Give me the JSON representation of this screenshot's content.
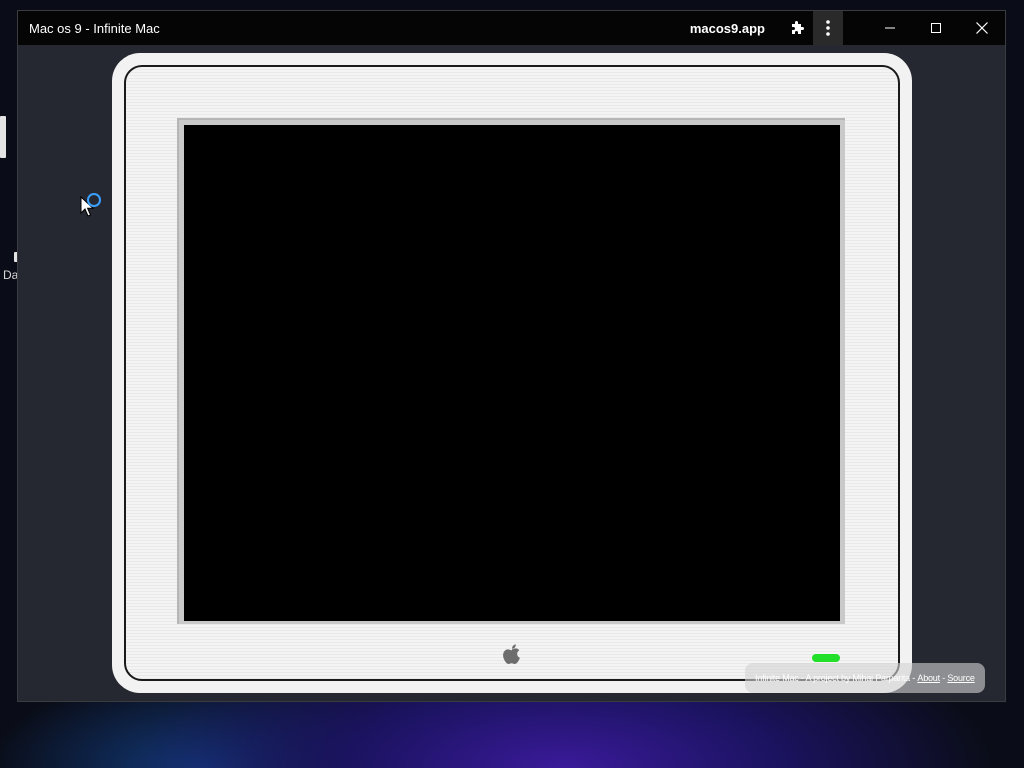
{
  "window": {
    "title": "Mac os 9 - Infinite Mac",
    "domain": "macos9.app"
  },
  "titlebar_icons": {
    "extensions": "puzzle-icon",
    "menu": "kebab-menu-icon",
    "minimize": "minimize-icon",
    "maximize": "maximize-icon",
    "close": "close-icon"
  },
  "desktop": {
    "icon_2_label": "Da"
  },
  "footer": {
    "text": "Infinite Mac - A project by Mihai Parparita -",
    "about": "About",
    "separator": "-",
    "source": "Source"
  },
  "colors": {
    "titlebar": "#050505",
    "power_led": "#22e02a",
    "monitor": "#f2f2f2",
    "screen": "#000000"
  }
}
